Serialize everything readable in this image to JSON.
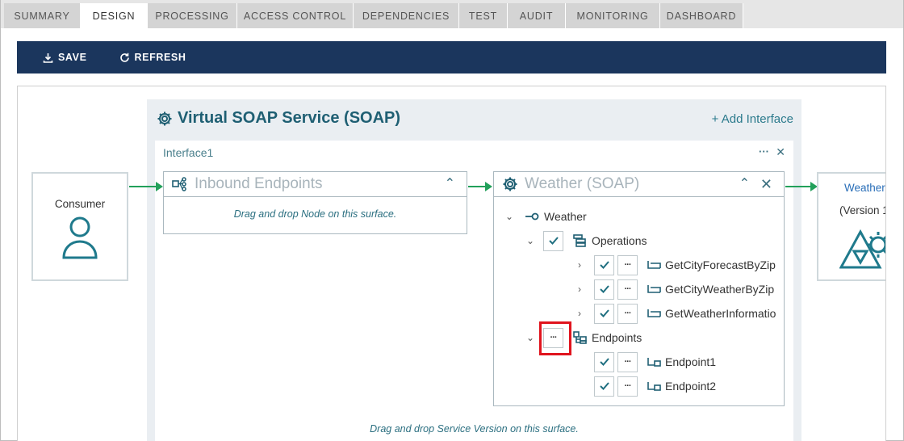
{
  "tabs": [
    {
      "label": "SUMMARY",
      "active": false
    },
    {
      "label": "DESIGN",
      "active": true
    },
    {
      "label": "PROCESSING",
      "active": false
    },
    {
      "label": "ACCESS CONTROL",
      "active": false
    },
    {
      "label": "DEPENDENCIES",
      "active": false
    },
    {
      "label": "TEST",
      "active": false
    },
    {
      "label": "AUDIT",
      "active": false
    },
    {
      "label": "MONITORING",
      "active": false
    },
    {
      "label": "DASHBOARD",
      "active": false
    }
  ],
  "toolbar": {
    "save_label": "SAVE",
    "refresh_label": "REFRESH"
  },
  "consumer": {
    "label": "Consumer"
  },
  "service": {
    "title": "Virtual SOAP Service (SOAP)",
    "add_interface": "+ Add Interface"
  },
  "interface": {
    "name": "Interface1",
    "more": "···",
    "close": "✕",
    "drop_hint": "Drag and drop Service Version on this surface."
  },
  "inbound": {
    "title": "Inbound Endpoints",
    "drop_hint": "Drag and drop Node on this surface."
  },
  "weather_panel": {
    "title": "Weather (SOAP)",
    "root": "Weather",
    "operations_label": "Operations",
    "operations": [
      "GetCityForecastByZip",
      "GetCityWeatherByZip",
      "GetWeatherInformatio"
    ],
    "endpoints_label": "Endpoints",
    "endpoints": [
      "Endpoint1",
      "Endpoint2"
    ]
  },
  "weather_card": {
    "name": "Weather",
    "version": "(Version 1"
  },
  "colors": {
    "toolbar": "#1b365d",
    "accent": "#1f5f73",
    "arrow": "#22a05a",
    "highlight": "#e0141e"
  }
}
